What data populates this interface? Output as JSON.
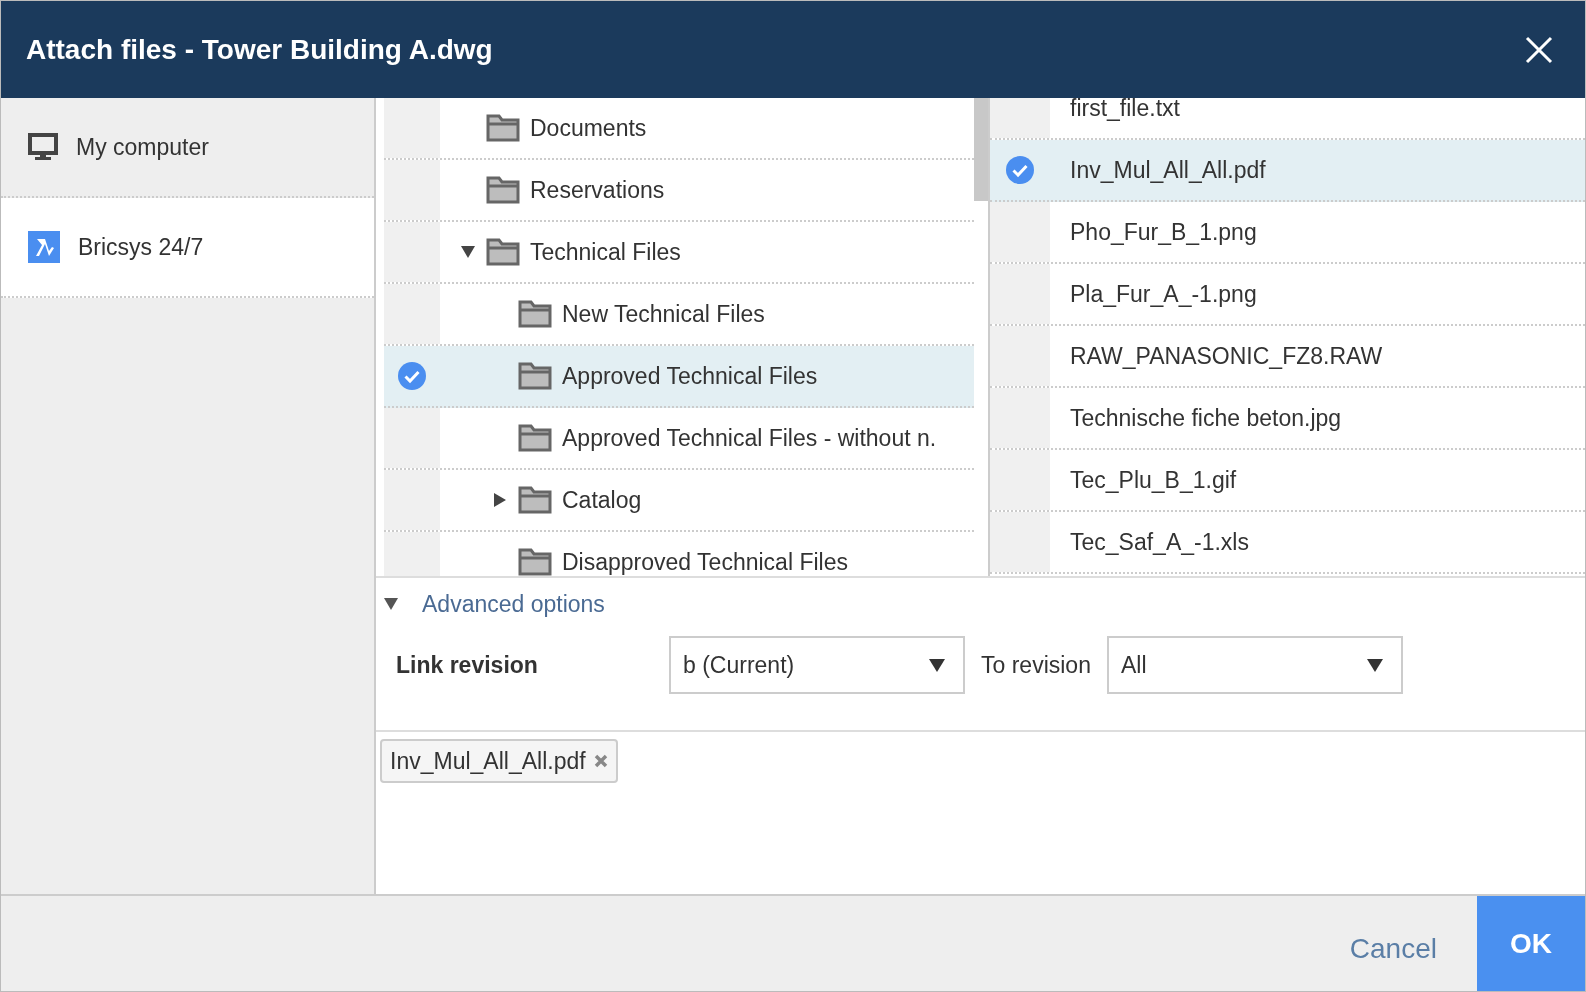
{
  "window": {
    "title": "Attach files - Tower Building A.dwg"
  },
  "sources": [
    {
      "label": "My computer",
      "kind": "computer",
      "selected": false
    },
    {
      "label": "Bricsys 24/7",
      "kind": "bricsys",
      "selected": true
    }
  ],
  "folders": [
    {
      "label": "Documents",
      "selected": false
    },
    {
      "label": "Reservations",
      "selected": false
    },
    {
      "label": "Technical Files",
      "selected": false,
      "expanded": true,
      "children": [
        {
          "label": "New Technical Files",
          "selected": false
        },
        {
          "label": "Approved Technical Files",
          "selected": true
        },
        {
          "label": "Approved Technical Files - without n.",
          "selected": false
        },
        {
          "label": "Catalog",
          "selected": false,
          "expanded": false
        },
        {
          "label": "Disapproved Technical Files",
          "selected": false
        }
      ]
    }
  ],
  "files": [
    {
      "name": "first_file.txt",
      "selected": false
    },
    {
      "name": "Inv_Mul_All_All.pdf",
      "selected": true
    },
    {
      "name": "Pho_Fur_B_1.png",
      "selected": false
    },
    {
      "name": "Pla_Fur_A_-1.png",
      "selected": false
    },
    {
      "name": "RAW_PANASONIC_FZ8.RAW",
      "selected": false
    },
    {
      "name": "Technische fiche beton.jpg",
      "selected": false
    },
    {
      "name": "Tec_Plu_B_1.gif",
      "selected": false
    },
    {
      "name": "Tec_Saf_A_-1.xls",
      "selected": false
    }
  ],
  "advanced_options": {
    "label": "Advanced options",
    "expanded": true
  },
  "link_revision": {
    "label": "Link revision",
    "value": "b (Current)",
    "to_label": "To revision",
    "to_value": "All"
  },
  "attached": [
    {
      "name": "Inv_Mul_All_All.pdf"
    }
  ],
  "buttons": {
    "cancel": "Cancel",
    "ok": "OK"
  }
}
